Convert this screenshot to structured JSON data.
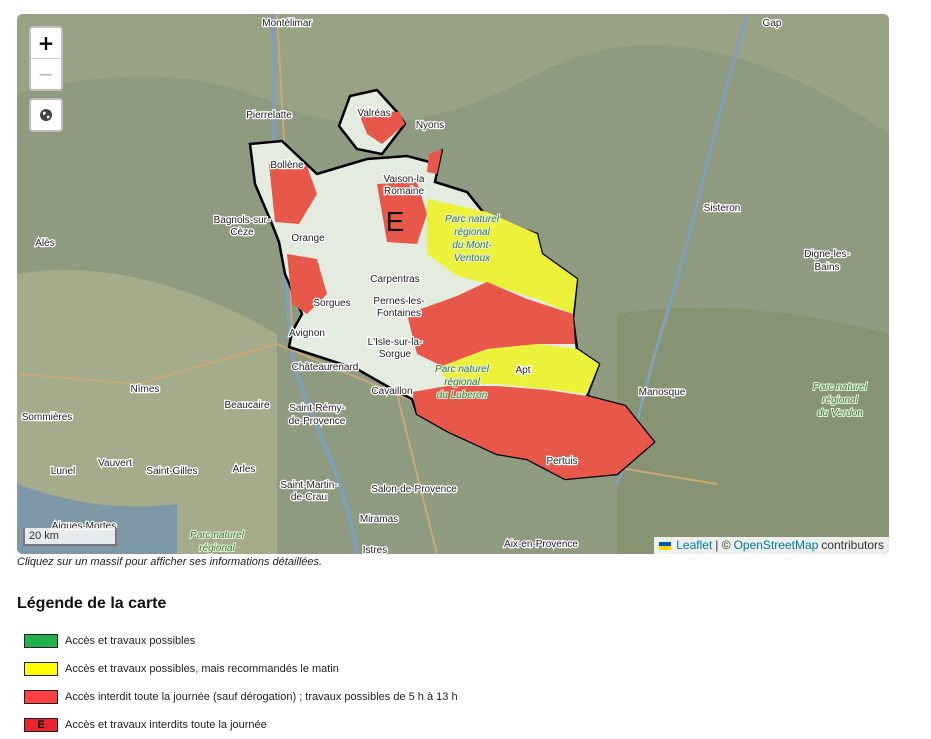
{
  "map": {
    "zoom_in": "+",
    "zoom_out": "−",
    "scale_label": "20 km",
    "attribution": {
      "leaflet": "Leaflet",
      "separator": " | © ",
      "osm": "OpenStreetMap",
      "contributors": " contributors"
    },
    "zone_marker": "E",
    "towns": [
      {
        "name": "Montélimar"
      },
      {
        "name": "Gap"
      },
      {
        "name": "Pierrelatte"
      },
      {
        "name": "Valréas"
      },
      {
        "name": "Nyons"
      },
      {
        "name": "Bollène"
      },
      {
        "name": "Vaison-la"
      },
      {
        "name": "Romaine"
      },
      {
        "name": "Sisteron"
      },
      {
        "name": "Bagnols-sur-"
      },
      {
        "name": "Cèze"
      },
      {
        "name": "Alès"
      },
      {
        "name": "Orange"
      },
      {
        "name": "Digne-les-"
      },
      {
        "name": "Bains"
      },
      {
        "name": "Carpentras"
      },
      {
        "name": "Pernes-les-"
      },
      {
        "name": "Fontaines"
      },
      {
        "name": "Sorgues"
      },
      {
        "name": "Avignon"
      },
      {
        "name": "L'Isle-sur-la-"
      },
      {
        "name": "Sorgue"
      },
      {
        "name": "Châteaurenard"
      },
      {
        "name": "Apt"
      },
      {
        "name": "Nîmes"
      },
      {
        "name": "Manosque"
      },
      {
        "name": "Cavaillon"
      },
      {
        "name": "Sommières"
      },
      {
        "name": "Beaucaire"
      },
      {
        "name": "Saint-Rémy-"
      },
      {
        "name": "de-Provence"
      },
      {
        "name": "Pertuis"
      },
      {
        "name": "Lunel"
      },
      {
        "name": "Vauvert"
      },
      {
        "name": "Saint-Gilles"
      },
      {
        "name": "Arles"
      },
      {
        "name": "Saint-Martin-"
      },
      {
        "name": "de-Crau"
      },
      {
        "name": "Salon-de-Provence"
      },
      {
        "name": "Aigues-Mortes"
      },
      {
        "name": "Miramas"
      },
      {
        "name": "Istres"
      },
      {
        "name": "Aix-en-Provence"
      }
    ],
    "parks": [
      {
        "lines": [
          "Parc naturel",
          "régional",
          "du Mont-",
          "Ventoux"
        ]
      },
      {
        "lines": [
          "Parc naturel",
          "régional",
          "du Luberon"
        ]
      },
      {
        "lines": [
          "Parc naturel",
          "régional",
          "du Verdon"
        ]
      },
      {
        "lines": [
          "Parc naturel",
          "régional"
        ]
      }
    ],
    "colors": {
      "green": "#22b14c",
      "yellow": "#ffff00",
      "red": "#ff4040",
      "dark_red": "#e8252d"
    }
  },
  "hint": "Cliquez sur un massif pour afficher ses informations détaillées.",
  "legend": {
    "title": "Légende de la carte",
    "items": [
      {
        "label": "Accès et travaux possibles",
        "color": "#22b14c",
        "mark": ""
      },
      {
        "label": "Accès et travaux possibles, mais recommandés le matin",
        "color": "#ffff00",
        "mark": ""
      },
      {
        "label": "Accès interdit toute la journée (sauf dérogation) ; travaux possibles de 5 h à 13 h",
        "color": "#ff4040",
        "mark": ""
      },
      {
        "label": "Accès et travaux interdits toute la journée",
        "color": "#e8252d",
        "mark": "E"
      }
    ]
  }
}
